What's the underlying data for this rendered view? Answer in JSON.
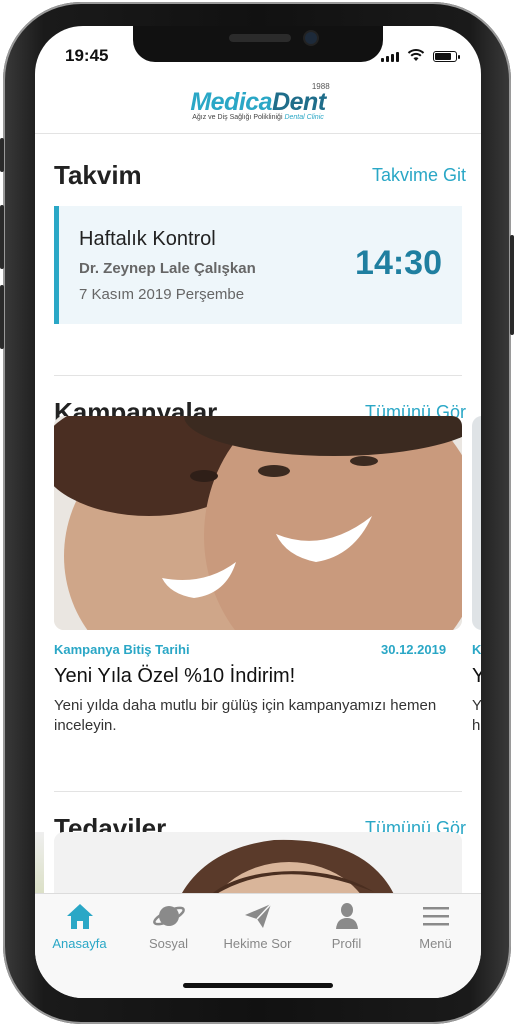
{
  "status_bar": {
    "time": "19:45"
  },
  "header": {
    "logo_medica": "Medica",
    "logo_dent": "Dent",
    "logo_year": "1988",
    "logo_subtitle": "Ağız ve Diş Sağlığı Polikliniği",
    "logo_subtitle_accent": "Dental Clinic"
  },
  "calendar": {
    "title": "Takvim",
    "link": "Takvime Git",
    "appointment": {
      "title": "Haftalık Kontrol",
      "doctor": "Dr. Zeynep Lale Çalışkan",
      "date": "7 Kasım 2019 Perşembe",
      "time": "14:30"
    }
  },
  "campaigns": {
    "title": "Kampanyalar",
    "link": "Tümünü Gör",
    "items": [
      {
        "end_label": "Kampanya Bitiş Tarihi",
        "end_date": "30.12.2019",
        "title": "Yeni Yıla Özel %10 İndirim!",
        "description": "Yeni yılda daha mutlu bir gülüş için kampanyamızı hemen inceleyin."
      }
    ],
    "peek": {
      "label": "K",
      "title": "Y",
      "desc1": "Y",
      "desc2": "h"
    }
  },
  "treatments": {
    "title": "Tedaviler",
    "link": "Tümünü Gör"
  },
  "tabbar": {
    "items": [
      {
        "label": "Anasayfa",
        "icon": "home-icon",
        "active": true
      },
      {
        "label": "Sosyal",
        "icon": "planet-icon",
        "active": false
      },
      {
        "label": "Hekime Sor",
        "icon": "paper-plane-icon",
        "active": false
      },
      {
        "label": "Profil",
        "icon": "user-icon",
        "active": false
      },
      {
        "label": "Menü",
        "icon": "menu-icon",
        "active": false
      }
    ]
  },
  "colors": {
    "accent": "#2aa7c6",
    "time_color": "#1f7fa0",
    "card_bg": "#eef6fa"
  }
}
